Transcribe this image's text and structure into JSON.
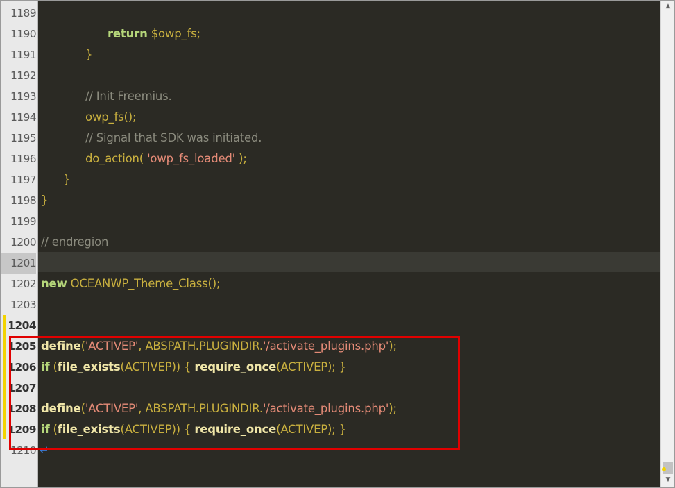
{
  "editor": {
    "line_numbers": [
      "1189",
      "1190",
      "1191",
      "1192",
      "1193",
      "1194",
      "1195",
      "1196",
      "1197",
      "1198",
      "1199",
      "1200",
      "1201",
      "1202",
      "1203",
      "1204",
      "1205",
      "1206",
      "1207",
      "1208",
      "1209",
      "1210"
    ],
    "current_line": "1201",
    "code": {
      "l1190_kw": "return",
      "l1190_var": " $owp_fs;",
      "l1191": "}",
      "l1193": "// Init Freemius.",
      "l1194": "owp_fs();",
      "l1195": "// Signal that SDK was initiated.",
      "l1196_fn": "do_action( ",
      "l1196_str": "'owp_fs_loaded'",
      "l1196_end": " );",
      "l1197": "}",
      "l1198": "}",
      "l1200": "// endregion",
      "l1202_kw": "new",
      "l1202_rest": " OCEANWP_Theme_Class();",
      "define_fn": "define",
      "define_open": "(",
      "define_str1": "'ACTIVEP'",
      "define_mid": ", ABSPATH.PLUGINDIR.",
      "define_str2": "'/activate_plugins.php'",
      "define_close": ");",
      "if_kw": "if",
      "if_open": " (",
      "if_fn": "file_exists",
      "if_arg": "(ACTIVEP)) { ",
      "req_fn": "require_once",
      "req_arg": "(ACTIVEP); }"
    }
  },
  "colors": {
    "editor_bg": "#2b2a24",
    "highlight_box": "#e10000",
    "change_marker": "#f2d300"
  }
}
